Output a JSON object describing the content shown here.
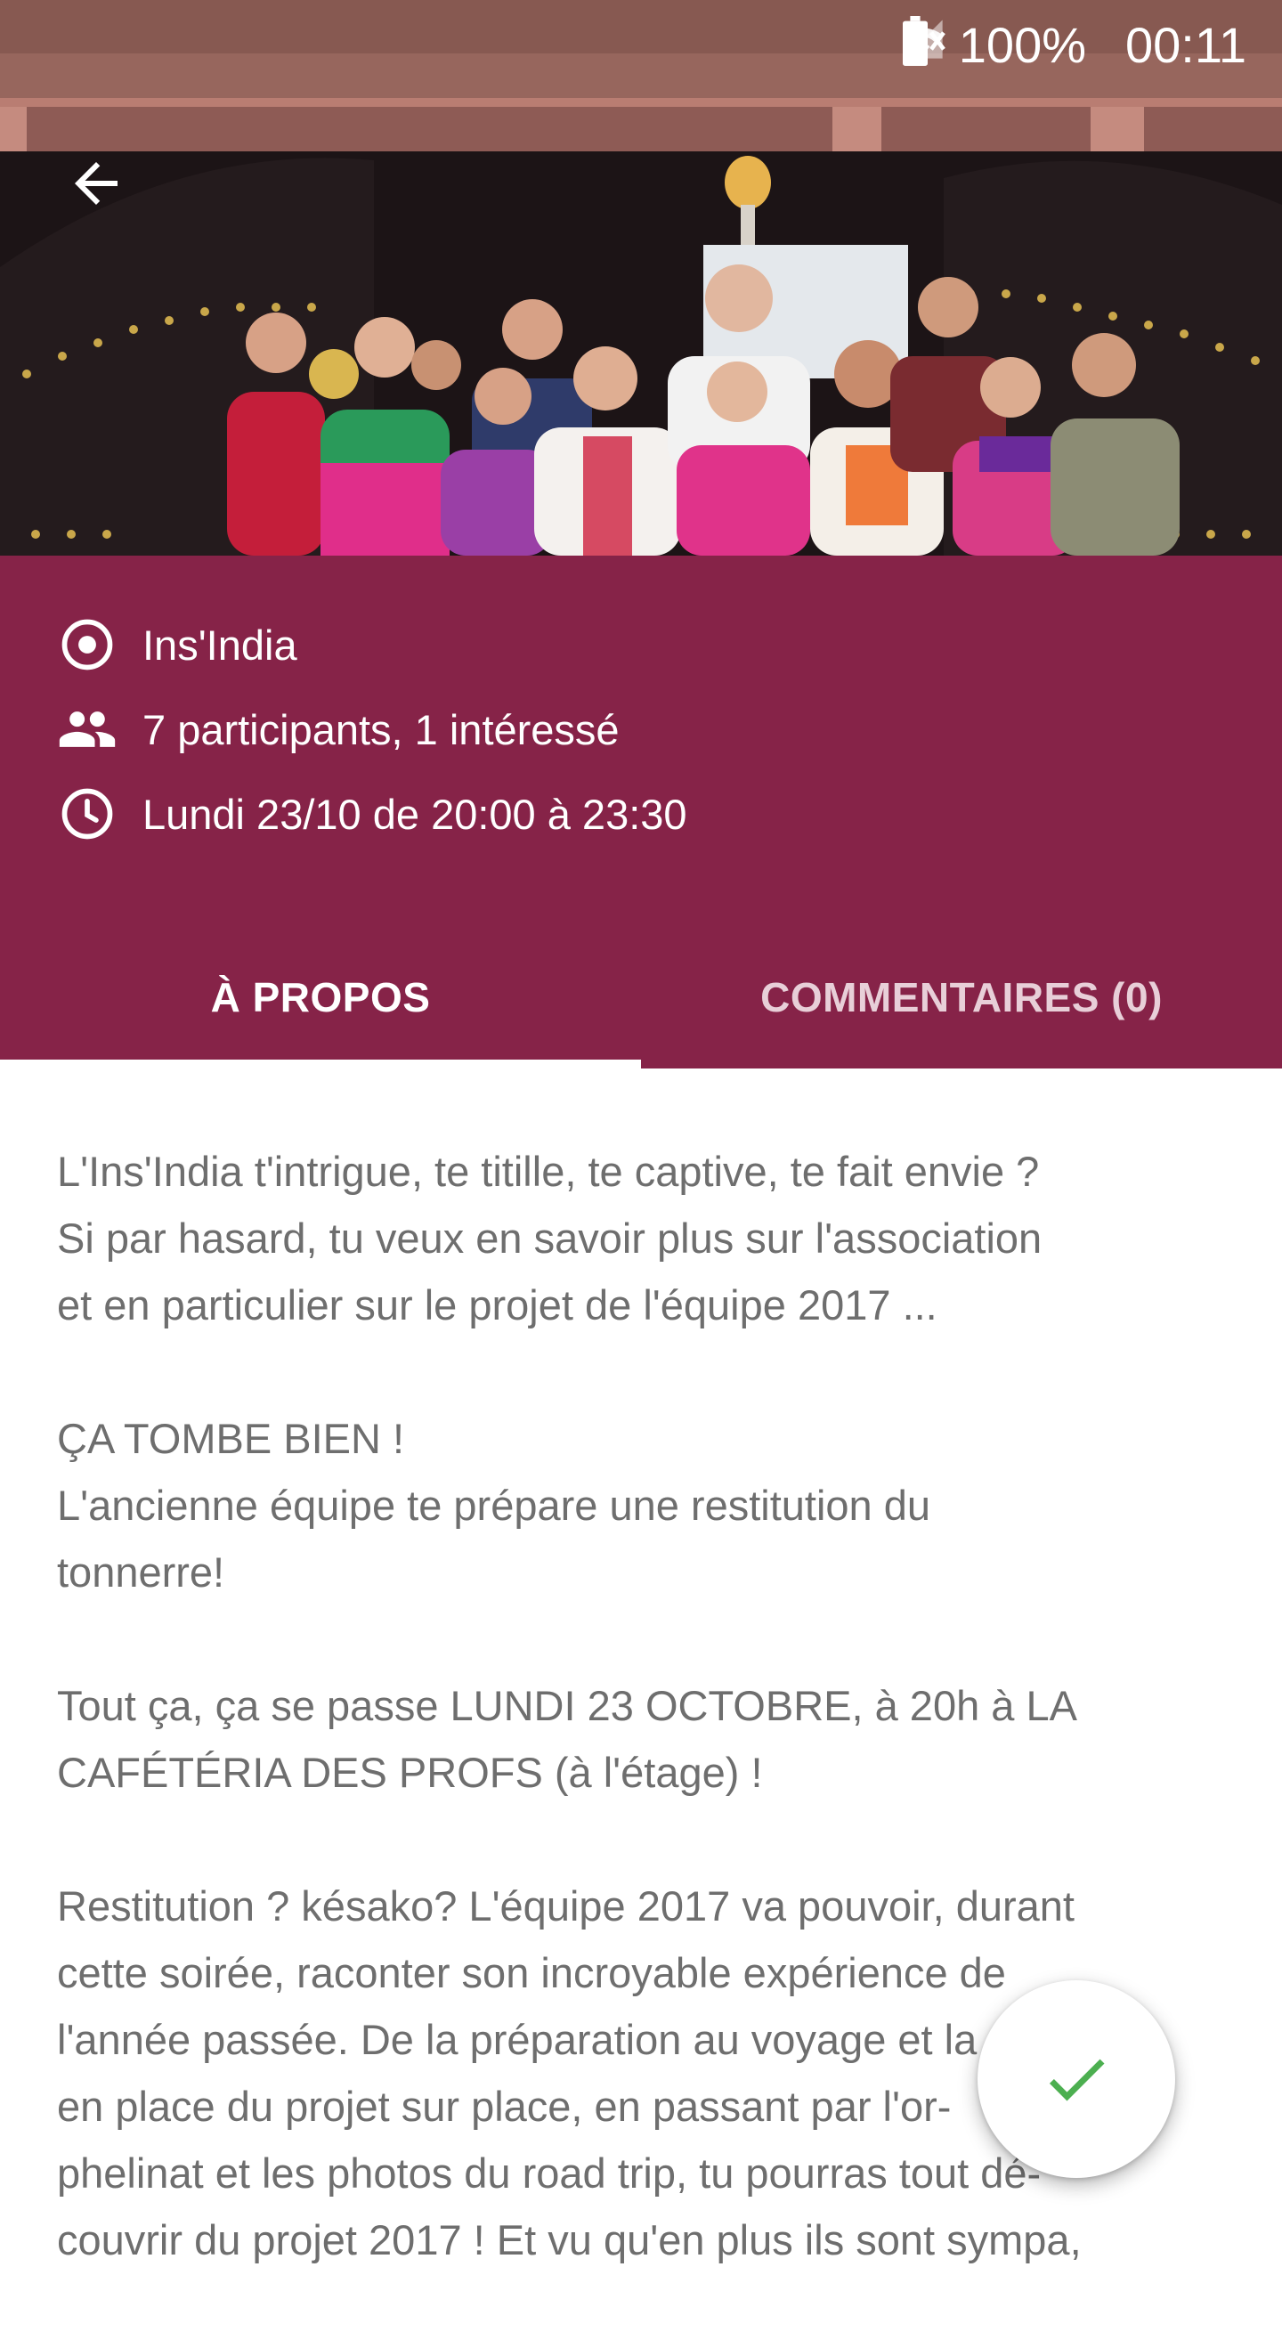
{
  "status_bar": {
    "battery_percent": "100%",
    "time": "00:11",
    "icons": [
      "mute-icon",
      "wifi-icon",
      "signal-icon",
      "battery-icon"
    ]
  },
  "header": {
    "back_icon": "arrow-left-icon"
  },
  "event": {
    "organizer": "Ins'India",
    "participants": "7 participants, 1 intéressé",
    "datetime": "Lundi 23/10 de 20:00 à 23:30",
    "accent_color": "#862348"
  },
  "tabs": [
    {
      "label": "À PROPOS",
      "active": true
    },
    {
      "label": "COMMENTAIRES (0)",
      "active": false
    }
  ],
  "description": {
    "paragraphs": [
      "L'Ins'India t'intrigue, te titille, te captive, te fait envie ?\nSi par hasard, tu veux en savoir plus sur l'association\net en particulier sur le projet de l'équipe 2017 ...",
      "ÇA TOMBE BIEN !\nL'ancienne équipe te prépare une restitution du\ntonnerre!",
      "Tout ça, ça se passe LUNDI 23 OCTOBRE, à 20h à LA\nCAFÉTÉRIA DES PROFS (à l'étage) !",
      "Restitution ? késako? L'équipe 2017 va pouvoir, durant\ncette soirée, raconter son incroyable expérience de\nl'année passée. De la préparation au voyage et la mise\nen place du projet sur place, en passant par l'or-\nphelinat et les photos du road trip, tu pourras tout dé-\ncouvrir du projet 2017 ! Et vu qu'en plus ils sont sympa,"
    ]
  },
  "fab": {
    "icon": "check-icon",
    "color": "#4caf50"
  }
}
